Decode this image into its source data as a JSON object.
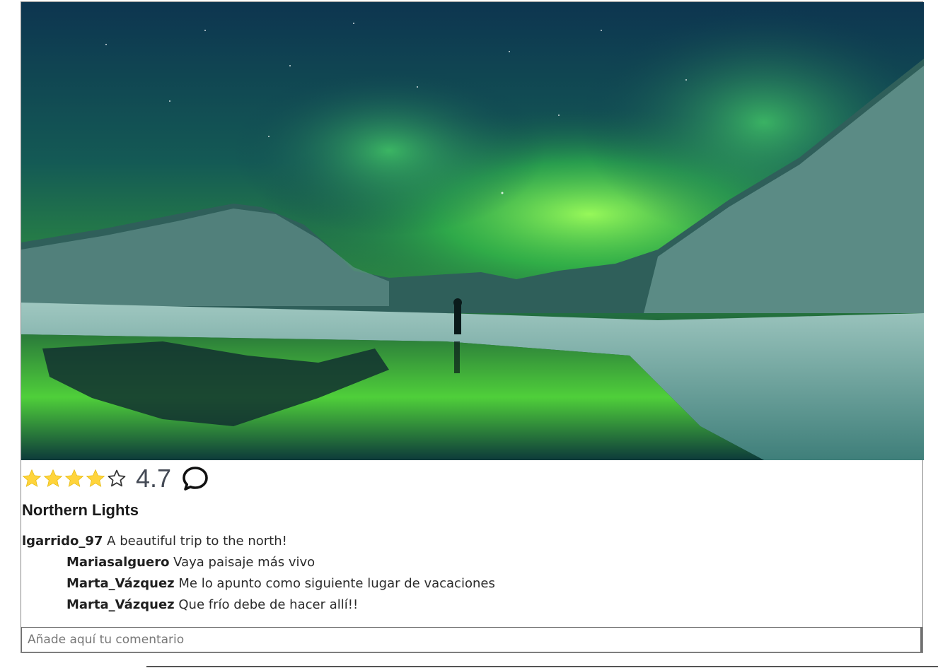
{
  "post": {
    "image_alt": "Northern Lights",
    "rating": {
      "value": 4.7,
      "value_label": "4.7",
      "stars_filled": 4,
      "stars_total": 5,
      "star_color": "#ffd43b"
    },
    "title": "Northern Lights"
  },
  "comments": [
    {
      "user": "lgarrido_97",
      "text": "A beautiful trip to the north!",
      "reply": false
    },
    {
      "user": "Mariasalguero",
      "text": "Vaya paisaje más vivo",
      "reply": true
    },
    {
      "user": "Marta_Vázquez",
      "text": "Me lo apunto como siguiente lugar de vacaciones",
      "reply": true
    },
    {
      "user": "Marta_Vázquez",
      "text": "Que frío debe de hacer allí!!",
      "reply": true
    }
  ],
  "comment_input": {
    "placeholder": "Añade aquí tu comentario",
    "value": ""
  },
  "icons": {
    "star": "star-icon",
    "comment": "comment-icon"
  }
}
